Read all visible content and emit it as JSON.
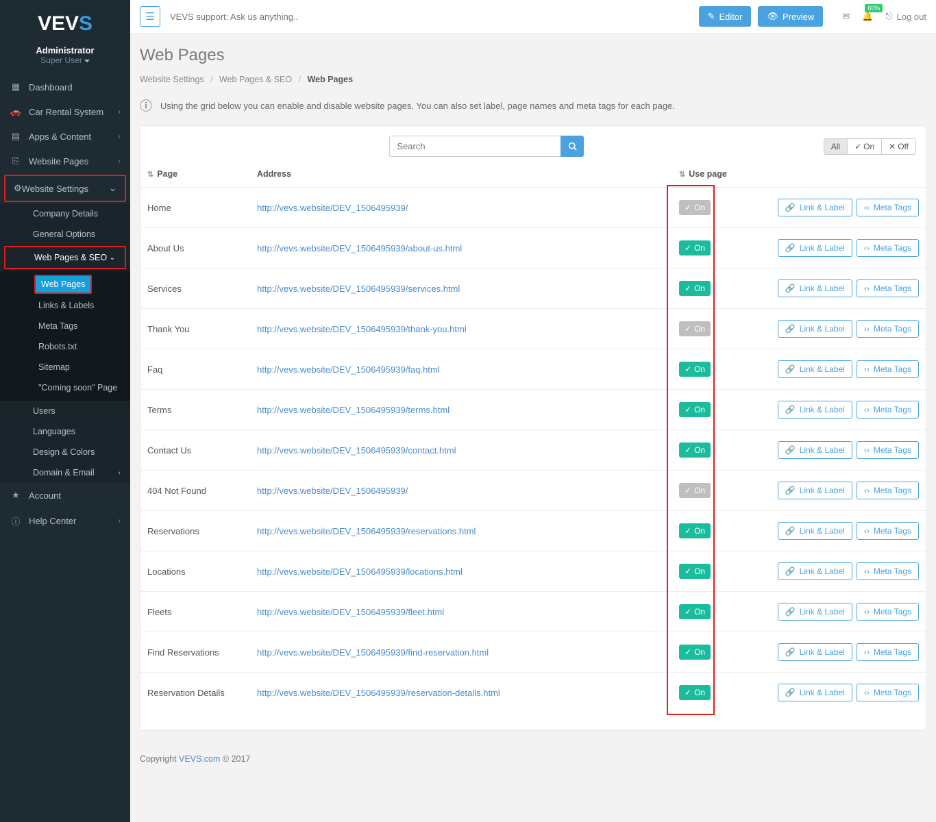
{
  "logo": {
    "v": "V",
    "e": "E",
    "v2": "V",
    "s": "S"
  },
  "user": {
    "role": "Administrator",
    "level": "Super User"
  },
  "nav": {
    "dashboard": "Dashboard",
    "car_rental": "Car Rental System",
    "apps": "Apps & Content",
    "web_pages": "Website Pages",
    "website_settings": "Website Settings",
    "account": "Account",
    "help": "Help Center"
  },
  "ws_sub": {
    "company": "Company Details",
    "general": "General Options",
    "wpseo": "Web Pages & SEO",
    "users": "Users",
    "languages": "Languages",
    "design": "Design & Colors",
    "domain": "Domain & Email"
  },
  "wpseo_sub": {
    "web_pages": "Web Pages",
    "links": "Links & Labels",
    "meta": "Meta Tags",
    "robots": "Robots.txt",
    "sitemap": "Sitemap",
    "coming": "\"Coming soon\" Page"
  },
  "topbar": {
    "support_placeholder": "VEVS support: Ask us anything..",
    "editor": "Editor",
    "preview": "Preview",
    "badge": "60%",
    "logout": "Log out"
  },
  "page": {
    "title": "Web Pages",
    "bc1": "Website Settings",
    "bc2": "Web Pages & SEO",
    "bc3": "Web Pages",
    "info": "Using the grid below you can enable and disable website pages. You can also set label, page names and meta tags for each page."
  },
  "toolbar": {
    "search_placeholder": "Search",
    "filter_all": "All",
    "filter_on": "On",
    "filter_off": "Off"
  },
  "columns": {
    "page": "Page",
    "address": "Address",
    "use": "Use page"
  },
  "row_buttons": {
    "link": "Link & Label",
    "meta": "Meta Tags",
    "on": "On"
  },
  "rows": [
    {
      "name": "Home",
      "url": "http://vevs.website/DEV_1506495939/",
      "on": true,
      "locked": true
    },
    {
      "name": "About Us",
      "url": "http://vevs.website/DEV_1506495939/about-us.html",
      "on": true,
      "locked": false
    },
    {
      "name": "Services",
      "url": "http://vevs.website/DEV_1506495939/services.html",
      "on": true,
      "locked": false
    },
    {
      "name": "Thank You",
      "url": "http://vevs.website/DEV_1506495939/thank-you.html",
      "on": true,
      "locked": true
    },
    {
      "name": "Faq",
      "url": "http://vevs.website/DEV_1506495939/faq.html",
      "on": true,
      "locked": false
    },
    {
      "name": "Terms",
      "url": "http://vevs.website/DEV_1506495939/terms.html",
      "on": true,
      "locked": false
    },
    {
      "name": "Contact Us",
      "url": "http://vevs.website/DEV_1506495939/contact.html",
      "on": true,
      "locked": false
    },
    {
      "name": "404 Not Found",
      "url": "http://vevs.website/DEV_1506495939/",
      "on": true,
      "locked": true
    },
    {
      "name": "Reservations",
      "url": "http://vevs.website/DEV_1506495939/reservations.html",
      "on": true,
      "locked": false
    },
    {
      "name": "Locations",
      "url": "http://vevs.website/DEV_1506495939/locations.html",
      "on": true,
      "locked": false
    },
    {
      "name": "Fleets",
      "url": "http://vevs.website/DEV_1506495939/fleet.html",
      "on": true,
      "locked": false
    },
    {
      "name": "Find Reservations",
      "url": "http://vevs.website/DEV_1506495939/find-reservation.html",
      "on": true,
      "locked": false
    },
    {
      "name": "Reservation Details",
      "url": "http://vevs.website/DEV_1506495939/reservation-details.html",
      "on": true,
      "locked": false
    }
  ],
  "footer": {
    "copyright": "Copyright ",
    "brand": "VEVS.com",
    "year": " © 2017"
  }
}
